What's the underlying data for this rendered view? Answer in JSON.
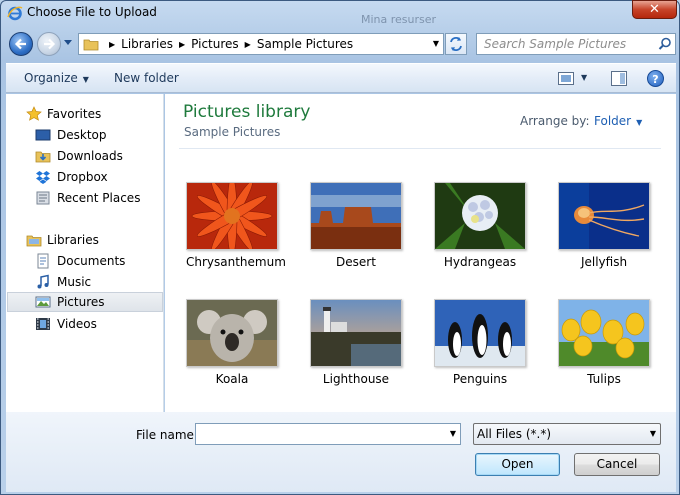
{
  "window": {
    "title": "Choose File to Upload",
    "close_label": "✕",
    "background_title": "Mina resurser"
  },
  "address": {
    "crumbs": [
      "Libraries",
      "Pictures",
      "Sample Pictures"
    ]
  },
  "search": {
    "placeholder": "Search Sample Pictures"
  },
  "toolbar": {
    "organize_label": "Organize",
    "new_folder_label": "New folder",
    "help_label": "?"
  },
  "nav": {
    "favorites_label": "Favorites",
    "favorites": [
      "Desktop",
      "Downloads",
      "Dropbox",
      "Recent Places"
    ],
    "libraries_label": "Libraries",
    "libraries": [
      "Documents",
      "Music",
      "Pictures",
      "Videos"
    ],
    "selected": "Pictures"
  },
  "content": {
    "title": "Pictures library",
    "subtitle": "Sample Pictures",
    "arrange_label": "Arrange by:",
    "arrange_value": "Folder",
    "items": [
      "Chrysanthemum",
      "Desert",
      "Hydrangeas",
      "Jellyfish",
      "Koala",
      "Lighthouse",
      "Penguins",
      "Tulips"
    ]
  },
  "footer": {
    "file_name_label": "File name:",
    "file_name_value": "",
    "filter_value": "All Files (*.*)",
    "open_label": "Open",
    "cancel_label": "Cancel"
  },
  "colors": {
    "library_title": "#1e7a3c",
    "link": "#1e5fb3",
    "selection": "#dfe4ea"
  }
}
